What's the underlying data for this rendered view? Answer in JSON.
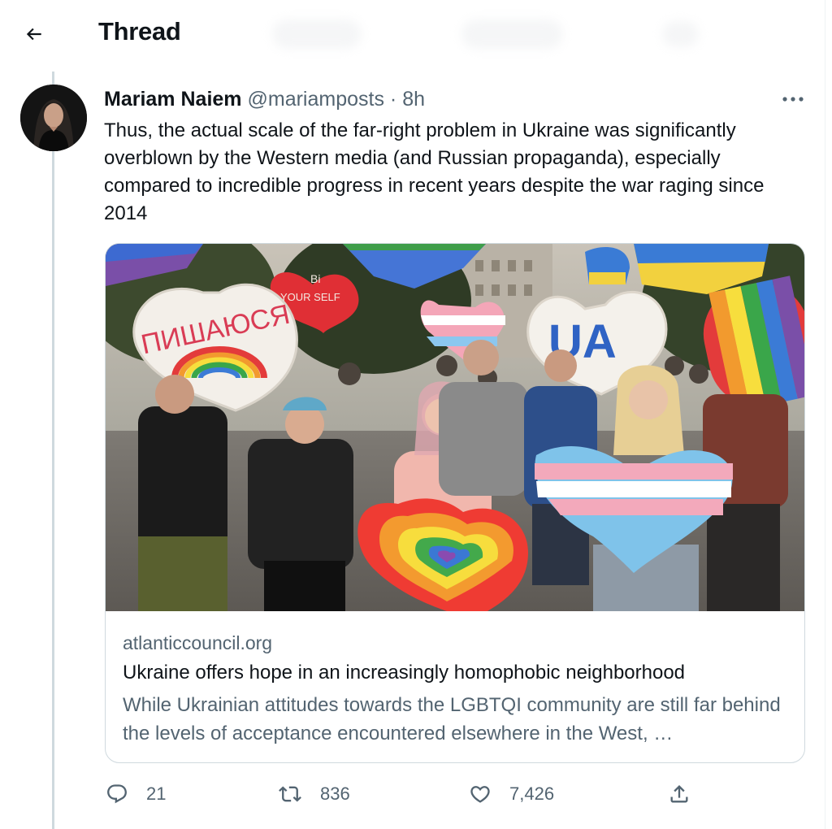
{
  "header": {
    "title": "Thread"
  },
  "tweet": {
    "author_name": "Mariam Naiem",
    "handle": "@mariamposts",
    "separator": "·",
    "time": "8h",
    "text": "Thus, the actual scale of the far-right problem in Ukraine was significantly overblown by the Western media (and Russian propaganda), especially compared to incredible progress in recent years despite the war raging since 2014"
  },
  "card": {
    "domain": "atlanticcouncil.org",
    "title": "Ukraine offers hope in an increasingly homophobic neighborhood",
    "description": "While Ukrainian attitudes towards the LGBTQI community are still far behind the levels of acceptance encountered elsewhere in the West, …",
    "image": {
      "sign_left": "ПИШАЮСЯ",
      "sign_be": "Bi",
      "sign_yourself": "YOUR SELF",
      "sign_ua": "UA"
    }
  },
  "actions": {
    "replies": "21",
    "retweets": "836",
    "likes": "7,426"
  },
  "icons": [
    "back-arrow-icon",
    "more-icon",
    "reply-icon",
    "retweet-icon",
    "like-icon",
    "share-icon"
  ],
  "colors": {
    "text": "#0f1419",
    "muted": "#536471",
    "border": "#cfd9de"
  }
}
